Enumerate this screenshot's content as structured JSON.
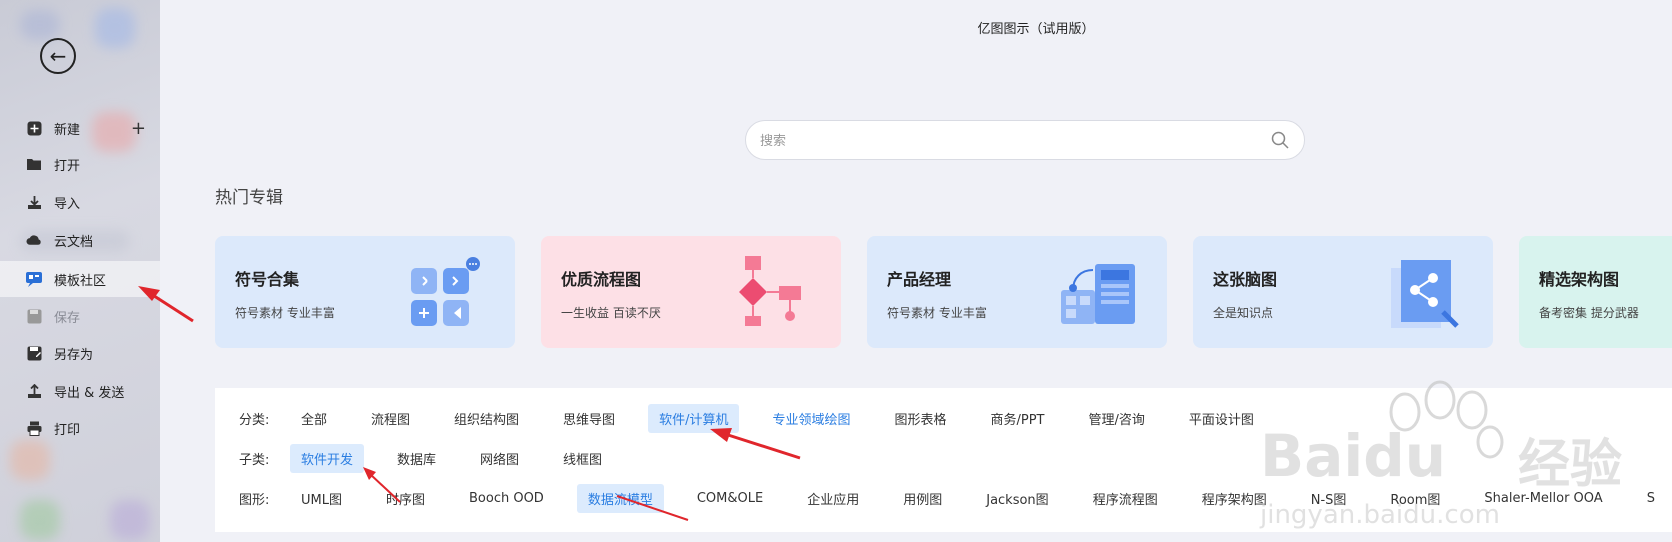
{
  "app": {
    "title": "亿图图示（试用版）"
  },
  "sidebar": {
    "back_icon": "arrow-left-circle-icon",
    "items": [
      {
        "label": "新建",
        "icon": "plus-square-icon",
        "state": "normal"
      },
      {
        "label": "打开",
        "icon": "folder-icon",
        "state": "normal"
      },
      {
        "label": "导入",
        "icon": "import-icon",
        "state": "normal"
      },
      {
        "label": "云文档",
        "icon": "cloud-icon",
        "state": "normal"
      },
      {
        "label": "模板社区",
        "icon": "template-community-icon",
        "state": "active"
      },
      {
        "label": "保存",
        "icon": "save-icon",
        "state": "disabled"
      },
      {
        "label": "另存为",
        "icon": "save-as-icon",
        "state": "normal"
      },
      {
        "label": "导出 & 发送",
        "icon": "export-icon",
        "state": "normal"
      },
      {
        "label": "打印",
        "icon": "print-icon",
        "state": "normal"
      }
    ]
  },
  "search": {
    "placeholder": "搜索"
  },
  "hot_section": {
    "title": "热门专辑"
  },
  "cards": [
    {
      "title": "符号合集",
      "subtitle": "符号素材 专业丰富",
      "bg": "#dce9fb"
    },
    {
      "title": "优质流程图",
      "subtitle": "一生收益 百读不厌",
      "bg": "#fde0e6"
    },
    {
      "title": "产品经理",
      "subtitle": "符号素材 专业丰富",
      "bg": "#dce9fb"
    },
    {
      "title": "这张脑图",
      "subtitle": "全是知识点",
      "bg": "#dce9fb"
    },
    {
      "title": "精选架构图",
      "subtitle": "备考密集 提分武器",
      "bg": "#d8f3ee"
    }
  ],
  "filters": {
    "category": {
      "label": "分类:",
      "options": [
        "全部",
        "流程图",
        "组织结构图",
        "思维导图",
        "软件/计算机",
        "专业领域绘图",
        "图形表格",
        "商务/PPT",
        "管理/咨询",
        "平面设计图"
      ],
      "selected": "软件/计算机",
      "highlighted": "专业领域绘图"
    },
    "subcategory": {
      "label": "子类:",
      "options": [
        "软件开发",
        "数据库",
        "网络图",
        "线框图"
      ],
      "selected": "软件开发"
    },
    "shape": {
      "label": "图形:",
      "options": [
        "UML图",
        "时序图",
        "Booch OOD",
        "数据流模型",
        "COM&OLE",
        "企业应用",
        "用例图",
        "Jackson图",
        "程序流程图",
        "程序架构图",
        "N-S图",
        "Room图",
        "Shaler-Mellor OOA",
        "S"
      ],
      "selected": "数据流模型"
    }
  },
  "watermark": {
    "brand": "Baidu",
    "brand_cn": "经验",
    "url": "jingyan.baidu.com"
  },
  "colors": {
    "accent": "#2a7de1",
    "annotation": "#e0262c"
  }
}
